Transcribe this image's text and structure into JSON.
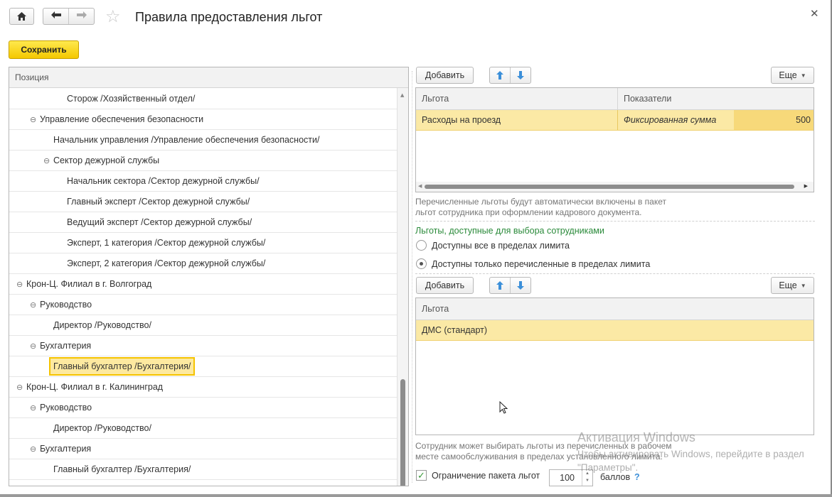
{
  "window": {
    "title": "Правила предоставления льгот"
  },
  "toolbar": {
    "save_label": "Сохранить"
  },
  "tree": {
    "header": "Позиция",
    "rows": [
      {
        "label": "Сторож /Хозяйственный отдел/",
        "level": 4,
        "expander": ""
      },
      {
        "label": "Управление обеспечения безопасности",
        "level": 2,
        "expander": "⊖"
      },
      {
        "label": "Начальник управления /Управление обеспечения безопасности/",
        "level": 3,
        "expander": ""
      },
      {
        "label": "Сектор дежурной службы",
        "level": 3,
        "expander": "⊖"
      },
      {
        "label": "Начальник сектора /Сектор дежурной службы/",
        "level": 4,
        "expander": ""
      },
      {
        "label": "Главный эксперт /Сектор дежурной службы/",
        "level": 4,
        "expander": ""
      },
      {
        "label": "Ведущий эксперт /Сектор дежурной службы/",
        "level": 4,
        "expander": ""
      },
      {
        "label": "Эксперт, 1 категория /Сектор дежурной службы/",
        "level": 4,
        "expander": ""
      },
      {
        "label": "Эксперт, 2 категория /Сектор дежурной службы/",
        "level": 4,
        "expander": ""
      },
      {
        "label": "Крон-Ц. Филиал в г. Волгоград",
        "level": 1,
        "expander": "⊖"
      },
      {
        "label": "Руководство",
        "level": 2,
        "expander": "⊖"
      },
      {
        "label": "Директор /Руководство/",
        "level": 3,
        "expander": ""
      },
      {
        "label": "Бухгалтерия",
        "level": 2,
        "expander": "⊖"
      },
      {
        "label": "Главный бухгалтер /Бухгалтерия/",
        "level": 3,
        "expander": "",
        "selected": true
      },
      {
        "label": "Крон-Ц. Филиал в г. Калининград",
        "level": 1,
        "expander": "⊖"
      },
      {
        "label": "Руководство",
        "level": 2,
        "expander": "⊖"
      },
      {
        "label": "Директор /Руководство/",
        "level": 3,
        "expander": ""
      },
      {
        "label": "Бухгалтерия",
        "level": 2,
        "expander": "⊖"
      },
      {
        "label": "Главный бухгалтер /Бухгалтерия/",
        "level": 3,
        "expander": ""
      }
    ]
  },
  "benefits_top": {
    "add_label": "Добавить",
    "more_label": "Еще",
    "columns": [
      "Льгота",
      "Показатели"
    ],
    "rows": [
      {
        "benefit": "Расходы на проезд",
        "indicator": "Фиксированная сумма",
        "value": "500"
      }
    ],
    "note_line1": "Перечисленные льготы будут автоматически включены в пакет",
    "note_line2": "льгот сотрудника при оформлении кадрового документа."
  },
  "choice_section": {
    "title": "Льготы, доступные для выбора сотрудниками",
    "option_all": "Доступны все в пределах лимита",
    "option_listed": "Доступны только перечисленные в пределах лимита",
    "selected": "option_listed"
  },
  "benefits_bottom": {
    "add_label": "Добавить",
    "more_label": "Еще",
    "columns": [
      "Льгота"
    ],
    "rows": [
      {
        "benefit": "ДМС (стандарт)"
      }
    ],
    "note_line1": "Сотрудник может выбирать льготы из перечисленных в рабочем",
    "note_line2": "месте самообслуживания в пределах установленного лимита."
  },
  "limit": {
    "checkbox_label": "Ограничение пакета льгот",
    "checked": true,
    "value": "100",
    "units": "баллов",
    "help": "?"
  },
  "watermark": {
    "line1": "Активация Windows",
    "line2": "Чтобы активировать Windows, перейдите в раздел \"Параметры\"."
  }
}
